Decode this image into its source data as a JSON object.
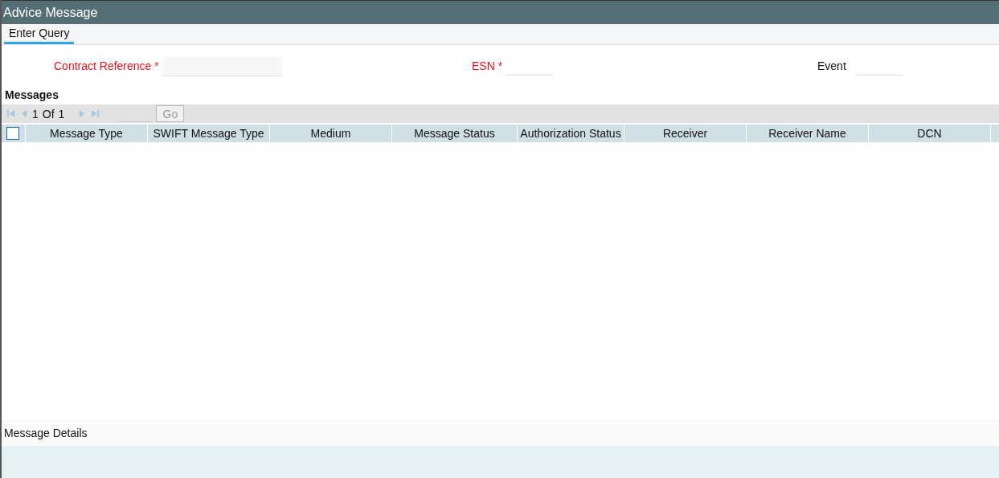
{
  "window": {
    "title": "Advice Message"
  },
  "toolbar": {
    "tabs": [
      {
        "label": "Enter Query",
        "selected": true
      }
    ]
  },
  "fields": [
    {
      "label": "Contract Reference",
      "required": true,
      "required_mark": "*"
    },
    {
      "label": "ESN",
      "required": true,
      "required_mark": "*"
    },
    {
      "label": "Event",
      "required": false
    }
  ],
  "messages": {
    "title": "Messages",
    "pager": {
      "current": "1",
      "of": "Of",
      "total": "1",
      "go": {
        "label": "Go",
        "disabled": true
      }
    },
    "select_all": {
      "checked": false
    },
    "columns": [
      "Message Type",
      "SWIFT Message Type",
      "Medium",
      "Message Status",
      "Authorization Status",
      "Receiver",
      "Receiver Name",
      "DCN"
    ]
  },
  "message_details": {
    "title": "Message Details"
  }
}
